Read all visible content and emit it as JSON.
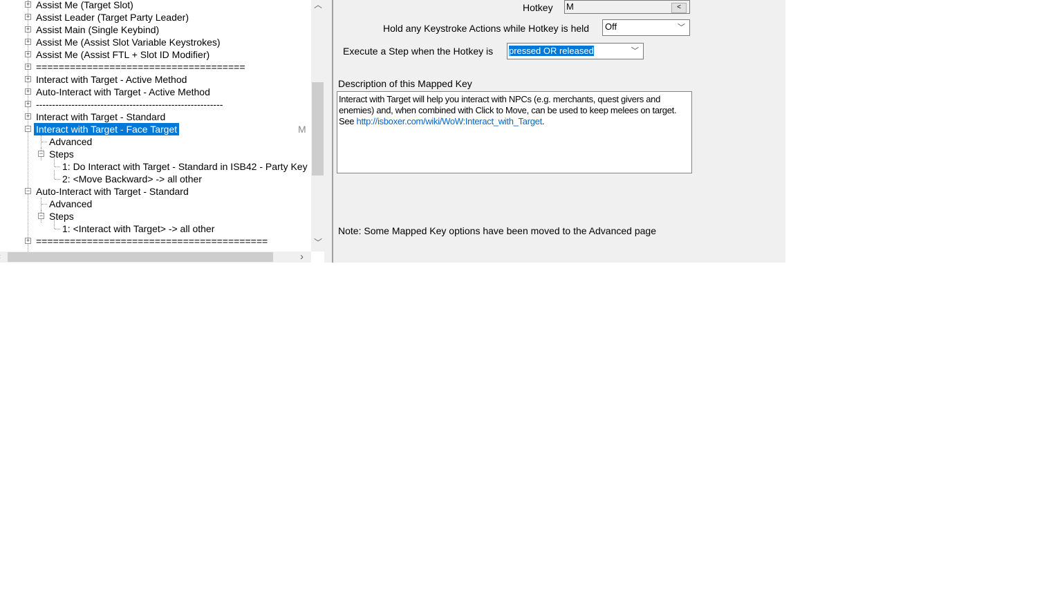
{
  "tree": {
    "items": [
      {
        "label": "Assist Me (Target Slot)",
        "level": 0,
        "expander": "plus"
      },
      {
        "label": "Assist Leader (Target Party Leader)",
        "level": 0,
        "expander": "plus"
      },
      {
        "label": "Assist Main (Single Keybind)",
        "level": 0,
        "expander": "plus"
      },
      {
        "label": "Assist Me (Assist Slot Variable Keystrokes)",
        "level": 0,
        "expander": "plus"
      },
      {
        "label": "Assist Me (Assist FTL + Slot ID Modifier)",
        "level": 0,
        "expander": "plus"
      },
      {
        "label": "=====================================",
        "level": 0,
        "expander": "plus"
      },
      {
        "label": "Interact with Target - Active Method",
        "level": 0,
        "expander": "plus"
      },
      {
        "label": "Auto-Interact with Target - Active Method",
        "level": 0,
        "expander": "plus"
      },
      {
        "label": "----------------------------------------------------------",
        "level": 0,
        "expander": "plus"
      },
      {
        "label": "Interact with Target - Standard",
        "level": 0,
        "expander": "plus"
      },
      {
        "label": "Interact with Target - Face Target",
        "level": 0,
        "expander": "minus",
        "selected": true,
        "hotkey": "M"
      },
      {
        "label": "Advanced",
        "level": 1,
        "expander": "none"
      },
      {
        "label": "Steps",
        "level": 1,
        "expander": "minus"
      },
      {
        "label": "1: Do Interact with Target - Standard in ISB42 - Party Key",
        "level": 2,
        "expander": "none"
      },
      {
        "label": "2: <Move Backward> -> all other",
        "level": 2,
        "expander": "none"
      },
      {
        "label": "Auto-Interact with Target - Standard",
        "level": 0,
        "expander": "minus"
      },
      {
        "label": "Advanced",
        "level": 1,
        "expander": "none"
      },
      {
        "label": "Steps",
        "level": 1,
        "expander": "minus"
      },
      {
        "label": "1: <Interact with Target> -> all other",
        "level": 2,
        "expander": "none"
      },
      {
        "label": "=========================================",
        "level": 0,
        "expander": "plus"
      }
    ]
  },
  "form": {
    "hotkey_label": "Hotkey",
    "hotkey_value": "M",
    "hotkey_button": "<",
    "hold_label": "Hold any Keystroke Actions while Hotkey is held",
    "hold_value": "Off",
    "execute_label": "Execute a Step when the Hotkey is",
    "execute_value": "pressed OR released",
    "description_label": "Description of this Mapped Key",
    "description_text": "Interact with Target will help you interact with NPCs (e.g. merchants, quest givers and enemies) and, when combined with Click to Move, can be used to keep melees on target.",
    "description_see": "See ",
    "description_link": "http://isboxer.com/wiki/WoW:Interact_with_Target",
    "description_end": ".",
    "note": "Note: Some Mapped Key options have been moved to the Advanced page"
  },
  "colors": {
    "selection": "#0078d7",
    "link": "#0066cc",
    "panel": "#f0f0f0"
  }
}
